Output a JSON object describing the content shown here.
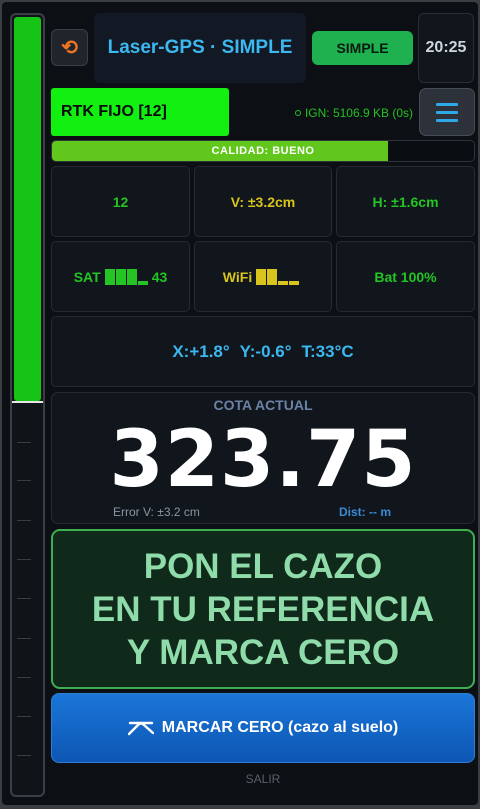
{
  "level_bar": {
    "fill_fraction": 0.495
  },
  "header": {
    "undo_icon": "refresh-icon",
    "title": "Laser-GPS · SIMPLE",
    "mode_button": "SIMPLE",
    "clock": "20:25"
  },
  "status": {
    "rtk": "RTK FIJO [12]",
    "ign": "IGN: 5106.9 KB (0s)",
    "menu_icon": "hamburger-icon"
  },
  "quality": {
    "label": "CALIDAD: BUENO",
    "fraction": 0.796
  },
  "metrics": {
    "sats": "12",
    "vert": "V: ±3.2cm",
    "horiz": "H: ±1.6cm",
    "sat_label": "SAT",
    "sat_value": "43",
    "wifi_label": "WiFi",
    "battery": "Bat 100%"
  },
  "tilt": {
    "x": "X:+1.8°",
    "y": "Y:-0.6°",
    "t": "T:33°C"
  },
  "cota": {
    "label": "COTA ACTUAL",
    "value": "323.75",
    "error_v": "Error V: ±3.2 cm",
    "dist": "Dist: -- m"
  },
  "instruction": {
    "line1": "PON EL CAZO",
    "line2": "EN TU REFERENCIA",
    "line3": "Y MARCA CERO"
  },
  "actions": {
    "zero_button": "MARCAR CERO (cazo al suelo)",
    "exit": "SALIR"
  },
  "colors": {
    "accent_green": "#11f011",
    "accent_blue": "#3cb8f0",
    "button_blue": "#1a76d8",
    "undo_orange": "#f07420"
  }
}
